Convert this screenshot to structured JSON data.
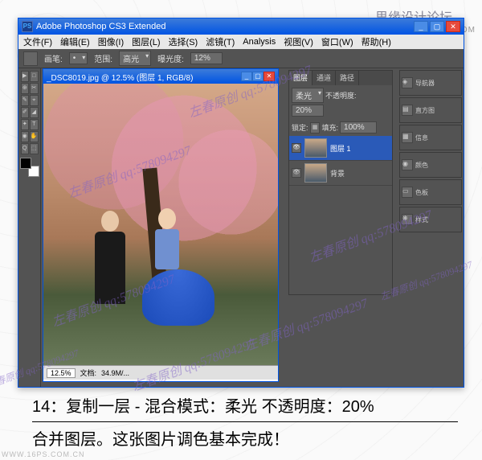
{
  "site": {
    "topForum": "思缘设计论坛",
    "topUrl": "WWW.MISSYUAN.COM",
    "bottomUrl": "WWW.16PS.COM.CN"
  },
  "watermark": {
    "text": "左春原创 qq:578094297"
  },
  "app": {
    "title": "Adobe Photoshop CS3 Extended",
    "titleIcon": "PS",
    "menu": [
      "文件(F)",
      "编辑(E)",
      "图像(I)",
      "图层(L)",
      "选择(S)",
      "滤镜(T)",
      "Analysis",
      "视图(V)",
      "窗口(W)",
      "帮助(H)"
    ],
    "winbtns": {
      "min": "_",
      "max": "▢",
      "close": "✕"
    }
  },
  "options": {
    "brushLabel": "画笔:",
    "rangeLabel": "范围:",
    "rangeValue": "高光",
    "exposureLabel": "曝光度:",
    "exposureValue": "12%"
  },
  "doc": {
    "title": "_DSC8019.jpg @ 12.5% (图层 1, RGB/8)",
    "zoom": "12.5%",
    "fileSizeLabel": "文档:",
    "fileSize": "34.9M/..."
  },
  "layers": {
    "tabs": [
      "图层",
      "通道",
      "路径"
    ],
    "blendMode": "柔光",
    "opacityLabel": "不透明度:",
    "opacityValue": "20%",
    "lockLabel": "锁定:",
    "fillLabel": "填充:",
    "fillValue": "100%",
    "items": [
      {
        "name": "图层 1",
        "selected": true
      },
      {
        "name": "背景",
        "selected": false
      }
    ]
  },
  "sidePanels": [
    {
      "icon": "◈",
      "label": "导航器"
    },
    {
      "icon": "▤",
      "label": "直方图"
    },
    {
      "icon": "▦",
      "label": "信息"
    },
    {
      "icon": "◉",
      "label": "颜色"
    },
    {
      "icon": "▭",
      "label": "色板"
    },
    {
      "icon": "❋",
      "label": "样式"
    }
  ],
  "tools": [
    "▶",
    "□",
    "⊕",
    "✂",
    "✎",
    "⌖",
    "✐",
    "◢",
    "✦",
    "T",
    "◉",
    "✋",
    "Q",
    "⬚"
  ],
  "caption": {
    "line1": "14：复制一层 - 混合模式：柔光  不透明度：20%",
    "line2": "合并图层。这张图片调色基本完成！"
  }
}
